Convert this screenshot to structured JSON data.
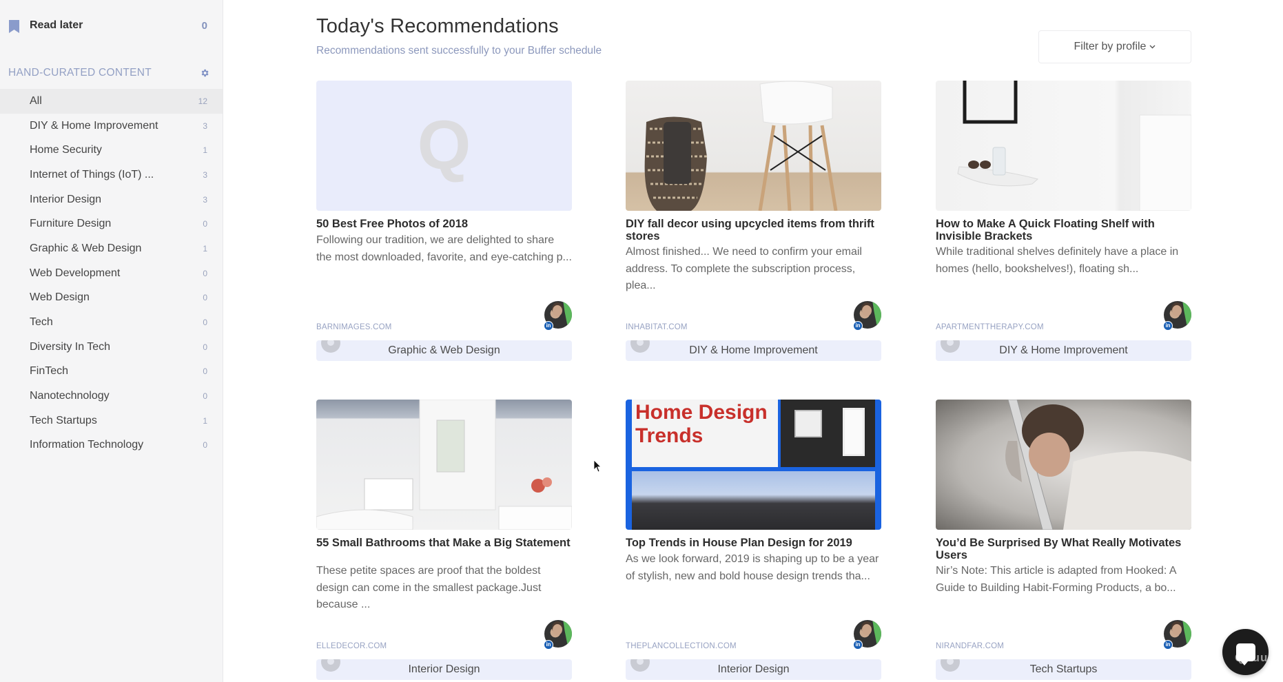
{
  "sidebar": {
    "read_later": {
      "label": "Read later",
      "count": "0"
    },
    "section_title": "HAND-CURATED CONTENT",
    "categories": [
      {
        "name": "All",
        "count": "12",
        "active": true
      },
      {
        "name": "DIY & Home Improvement",
        "count": "3"
      },
      {
        "name": "Home Security",
        "count": "1"
      },
      {
        "name": "Internet of Things (IoT) ...",
        "count": "3"
      },
      {
        "name": "Interior Design",
        "count": "3"
      },
      {
        "name": "Furniture Design",
        "count": "0"
      },
      {
        "name": "Graphic & Web Design",
        "count": "1"
      },
      {
        "name": "Web Development",
        "count": "0"
      },
      {
        "name": "Web Design",
        "count": "0"
      },
      {
        "name": "Tech",
        "count": "0"
      },
      {
        "name": "Diversity In Tech",
        "count": "0"
      },
      {
        "name": "FinTech",
        "count": "0"
      },
      {
        "name": "Nanotechnology",
        "count": "0"
      },
      {
        "name": "Tech Startups",
        "count": "1"
      },
      {
        "name": "Information Technology",
        "count": "0"
      }
    ]
  },
  "header": {
    "title": "Today's Recommendations",
    "subtitle": "Recommendations sent successfully to your Buffer schedule",
    "filter_label": "Filter by profile",
    "filter_chevron": "⌄"
  },
  "cards": [
    {
      "title": "50 Best Free Photos of 2018",
      "description": "Following our tradition, we are delighted to share the most downloaded, favorite, and eye-catching p...",
      "source": "BARNIMAGES.COM",
      "tag": "Graphic & Web Design",
      "image": "placeholder-q",
      "placeholder_glyph": "Q",
      "network": "in"
    },
    {
      "title": "DIY fall decor using upcycled items from thrift stores",
      "description": "Almost finished... We need to confirm your email address. To complete the subscription process, plea...",
      "source": "INHABITAT.COM",
      "tag": "DIY & Home Improvement",
      "image": "basket-and-chair-photo",
      "network": "in"
    },
    {
      "title": "How to Make A Quick Floating Shelf with Invisible Brackets",
      "description": "While traditional shelves definitely have a place in homes (hello, bookshelves!), floating sh...",
      "source": "APARTMENTTHERAPY.COM",
      "tag": "DIY & Home Improvement",
      "image": "floating-shelf-photo",
      "network": "in"
    },
    {
      "title": "55 Small Bathrooms that Make a Big Statement",
      "description": "These petite spaces are proof that the boldest design can come in the smallest package.Just because ...",
      "source": "ELLEDECOR.COM",
      "tag": "Interior Design",
      "image": "bathroom-photo",
      "network": "in"
    },
    {
      "title": "Top Trends in House Plan Design for 2019",
      "description": "As we look forward, 2019 is shaping up to be a year of stylish, new and bold house design trends tha...",
      "source": "THEPLANCOLLECTION.COM",
      "tag": "Interior Design",
      "image": "home-design-trends-collage",
      "image_text_line1": "Home Design",
      "image_text_line2": "Trends",
      "network": "in"
    },
    {
      "title": "You’d Be Surprised By What Really Motivates Users",
      "description": "Nir’s Note: This article is adapted from Hooked: A Guide to Building Habit-Forming Products, a bo...",
      "source": "NIRANDFAR.COM",
      "tag": "Tech Startups",
      "image": "man-through-laptop-photo",
      "network": "in"
    }
  ],
  "chat_widget": {
    "watermark": "Quuu"
  },
  "colors": {
    "accent": "#8392bd",
    "tag_bg": "#eceffb",
    "sidebar_bg": "#f5f5f6",
    "linkedin": "#1a5fb4"
  }
}
